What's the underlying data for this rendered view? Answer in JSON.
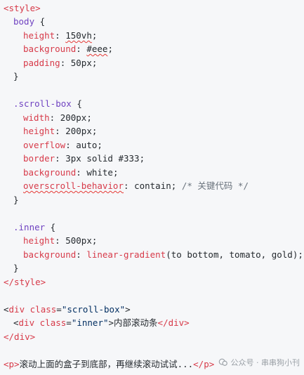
{
  "code": {
    "style_open": "<style>",
    "style_close": "</style>",
    "body_sel": "body",
    "body_height_prop": "height",
    "body_height_val": "150vh",
    "body_bg_prop": "background",
    "body_bg_val": "#eee",
    "body_pad_prop": "padding",
    "body_pad_val": "50px",
    "sb_sel": ".scroll-box",
    "sb_width_prop": "width",
    "sb_width_val": "200px",
    "sb_height_prop": "height",
    "sb_height_val": "200px",
    "sb_overflow_prop": "overflow",
    "sb_overflow_val": "auto",
    "sb_border_prop": "border",
    "sb_border_val": "3px solid #333",
    "sb_bg_prop": "background",
    "sb_bg_val": "white",
    "sb_osb_prop": "overscroll-behavior",
    "sb_osb_val": "contain",
    "sb_osb_comment": "/* 关键代码 */",
    "inner_sel": ".inner",
    "inner_height_prop": "height",
    "inner_height_val": "500px",
    "inner_bg_prop": "background",
    "inner_bg_fn": "linear-gradient",
    "inner_bg_args": "(to bottom, tomato, gold)",
    "div_open_tag": "div",
    "div_class_attr": "class",
    "div_class_val": "\"scroll-box\"",
    "inner_div_class_val": "\"inner\"",
    "inner_div_text": "内部滚动条",
    "div_close": "</div>",
    "p_text": "滚动上面的盒子到底部，再继续滚动试试...",
    "p_close": "</p>"
  },
  "watermark": {
    "text": "公众号 · 串串狗小刊"
  },
  "colors": {
    "tag": "#d73a49",
    "selector": "#6f42c1",
    "string": "#032f62",
    "comment": "#6a737d",
    "background": "#f6f7f9"
  }
}
